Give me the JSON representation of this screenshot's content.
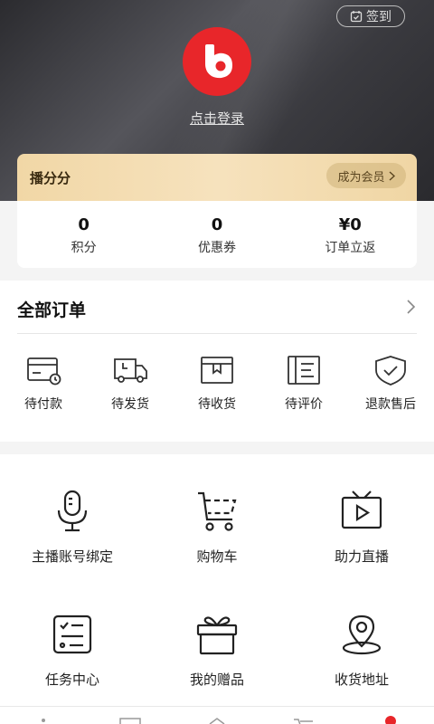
{
  "header": {
    "checkin_label": "签到",
    "login_label": "点击登录",
    "avatar_color": "#e8262a"
  },
  "member": {
    "title": "播分分",
    "button_label": "成为会员"
  },
  "stats": [
    {
      "value": "0",
      "label": "积分"
    },
    {
      "value": "0",
      "label": "优惠券"
    },
    {
      "value": "¥0",
      "label": "订单立返"
    }
  ],
  "orders": {
    "title": "全部订单",
    "items": [
      {
        "label": "待付款",
        "icon": "card-icon"
      },
      {
        "label": "待发货",
        "icon": "truck-icon"
      },
      {
        "label": "待收货",
        "icon": "box-icon"
      },
      {
        "label": "待评价",
        "icon": "review-icon"
      },
      {
        "label": "退款售后",
        "icon": "shield-icon"
      }
    ]
  },
  "services": [
    {
      "label": "主播账号绑定",
      "icon": "microphone-icon"
    },
    {
      "label": "购物车",
      "icon": "cart-icon"
    },
    {
      "label": "助力直播",
      "icon": "tv-icon"
    },
    {
      "label": "任务中心",
      "icon": "task-icon"
    },
    {
      "label": "我的赠品",
      "icon": "gift-icon"
    },
    {
      "label": "收货地址",
      "icon": "location-icon"
    }
  ],
  "colors": {
    "accent": "#e8262a",
    "gold": "#f1d7a6"
  }
}
